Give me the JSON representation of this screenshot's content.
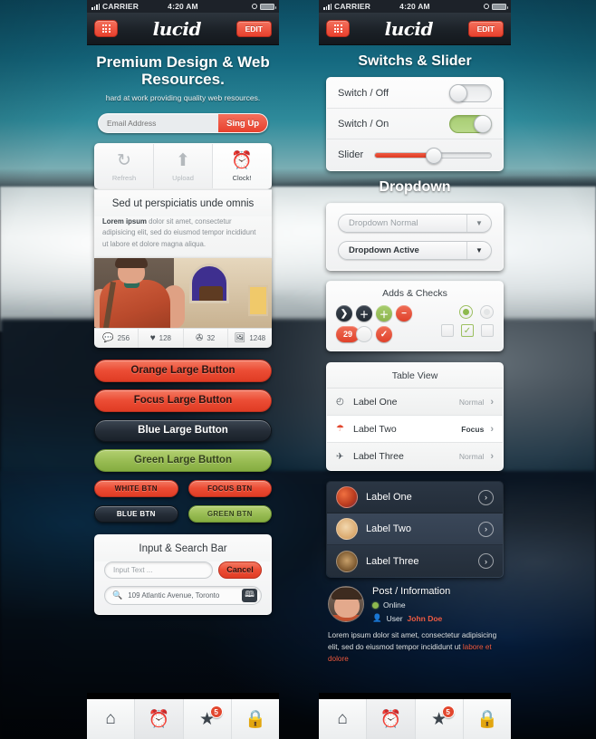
{
  "status_bar": {
    "carrier": "CARRIER",
    "time": "4:20 AM"
  },
  "navbar": {
    "brand": "lucid",
    "edit_label": "EDIT",
    "grid_icon": "grid-icon"
  },
  "left": {
    "hero": {
      "title": "Premium Design & Web Resources.",
      "subtitle": "hard at work providing quality web resources."
    },
    "signup": {
      "placeholder": "Email Address",
      "button": "Sing Up"
    },
    "icon_row": [
      {
        "icon": "refresh-icon",
        "glyph": "↻",
        "label": "Refresh"
      },
      {
        "icon": "upload-icon",
        "glyph": "⬆",
        "label": "Upload"
      },
      {
        "icon": "clock-icon",
        "glyph": "⏰",
        "label": "Clock!"
      }
    ],
    "article": {
      "title": "Sed ut perspiciatis unde omnis",
      "lead": "Lorem ipsum",
      "body": " dolor sit amet, consectetur adipisicing elit, sed do eiusmod tempor incididunt ut labore et dolore magna aliqua."
    },
    "photo_stats": [
      {
        "icon": "comment-icon",
        "glyph": "💬",
        "value": "256"
      },
      {
        "icon": "heart-icon",
        "glyph": "♥",
        "value": "128"
      },
      {
        "icon": "share-icon",
        "glyph": "✇",
        "value": "32"
      },
      {
        "icon": "photo-icon",
        "glyph": "🖼",
        "value": "1248"
      }
    ],
    "buttons": [
      {
        "label": "Orange Large Button",
        "style": "b-orange"
      },
      {
        "label": "Focus Large Button",
        "style": "b-focus"
      },
      {
        "label": "Blue Large Button",
        "style": "b-blue"
      },
      {
        "label": "Green Large Button",
        "style": "b-green"
      }
    ],
    "small_buttons": [
      {
        "label": "WHITE BTN",
        "style": "b-orange"
      },
      {
        "label": "FOCUS BTN",
        "style": "b-focus"
      },
      {
        "label": "BLUE BTN",
        "style": "b-blue"
      },
      {
        "label": "GREEN BTN",
        "style": "b-green"
      }
    ],
    "input_card": {
      "title": "Input & Search Bar",
      "input_placeholder": "Input Text ...",
      "cancel_label": "Cancel",
      "search_value": "109 Atlantic Avenue, Toronto",
      "search_icon": "search-icon",
      "book_icon": "book-icon"
    }
  },
  "right": {
    "switch_section": {
      "title": "Switchs & Slider",
      "rows": [
        {
          "label": "Switch / Off",
          "state": "off"
        },
        {
          "label": "Switch / On",
          "state": "on"
        }
      ],
      "slider_label": "Slider",
      "slider_value": 46
    },
    "dropdown_section": {
      "title": "Dropdown",
      "items": [
        {
          "label": "Dropdown Normal",
          "state": "normal"
        },
        {
          "label": "Dropdown Active",
          "state": "active"
        }
      ]
    },
    "checks_section": {
      "title": "Adds & Checks",
      "buttons": [
        {
          "name": "chevron-button",
          "glyph": "❯",
          "style": "dark"
        },
        {
          "name": "plus-dark-button",
          "glyph": "＋",
          "style": "dark"
        },
        {
          "name": "plus-green-button",
          "glyph": "＋",
          "style": "green"
        },
        {
          "name": "minus-red-button",
          "glyph": "−",
          "style": "red"
        },
        {
          "name": "count-badge",
          "glyph": "29",
          "style": "badge"
        },
        {
          "name": "empty-circle-button",
          "glyph": "",
          "style": "white"
        },
        {
          "name": "check-red-button",
          "glyph": "✓",
          "style": "red"
        }
      ],
      "radios": [
        {
          "state": "on"
        },
        {
          "state": "off"
        }
      ],
      "checkboxes": [
        {
          "state": "off"
        },
        {
          "state": "on"
        },
        {
          "state": "off"
        }
      ]
    },
    "table_section": {
      "title": "Table View",
      "rows": [
        {
          "icon": "clock-icon",
          "glyph": "◴",
          "label": "Label One",
          "meta": "Normal",
          "state": "normal"
        },
        {
          "icon": "umbrella-icon",
          "glyph": "☂",
          "label": "Label Two",
          "meta": "Focus",
          "state": "focus"
        },
        {
          "icon": "airplane-icon",
          "glyph": "✈",
          "label": "Label Three",
          "meta": "Normal",
          "state": "normal"
        }
      ]
    },
    "dark_list": [
      {
        "label": "Label One",
        "avatar": "avatar-character-red"
      },
      {
        "label": "Label Two",
        "avatar": "avatar-person-blonde"
      },
      {
        "label": "Label Three",
        "avatar": "avatar-leopard"
      }
    ],
    "post": {
      "title": "Post / Information",
      "status": "Online",
      "user_prefix": "User",
      "user_name": "John Doe",
      "body": "Lorem ipsum dolor sit amet, consectetur adipisicing elit, sed do eiusmod tempor incididunt ut ",
      "body_highlight": "labore et dolore"
    }
  },
  "tabbar": {
    "left_tabs": [
      {
        "icon": "home-icon",
        "glyph": "⌂",
        "selected": false,
        "active_color": false
      },
      {
        "icon": "alarm-clock-icon",
        "glyph": "⏰",
        "selected": true,
        "active_color": false
      },
      {
        "icon": "star-icon",
        "glyph": "★",
        "selected": false,
        "badge": "5"
      },
      {
        "icon": "lock-icon",
        "glyph": "🔒",
        "selected": false
      }
    ],
    "right_tabs": [
      {
        "icon": "home-icon",
        "glyph": "⌂",
        "selected": false,
        "active_color": false
      },
      {
        "icon": "alarm-clock-icon",
        "glyph": "⏰",
        "selected": true,
        "active_color": true
      },
      {
        "icon": "star-icon",
        "glyph": "★",
        "selected": false,
        "badge": "5"
      },
      {
        "icon": "lock-icon",
        "glyph": "🔒",
        "selected": false
      }
    ]
  },
  "colors": {
    "accent_red": "#e2472e",
    "accent_green": "#8db94e",
    "dark": "#232d39"
  }
}
